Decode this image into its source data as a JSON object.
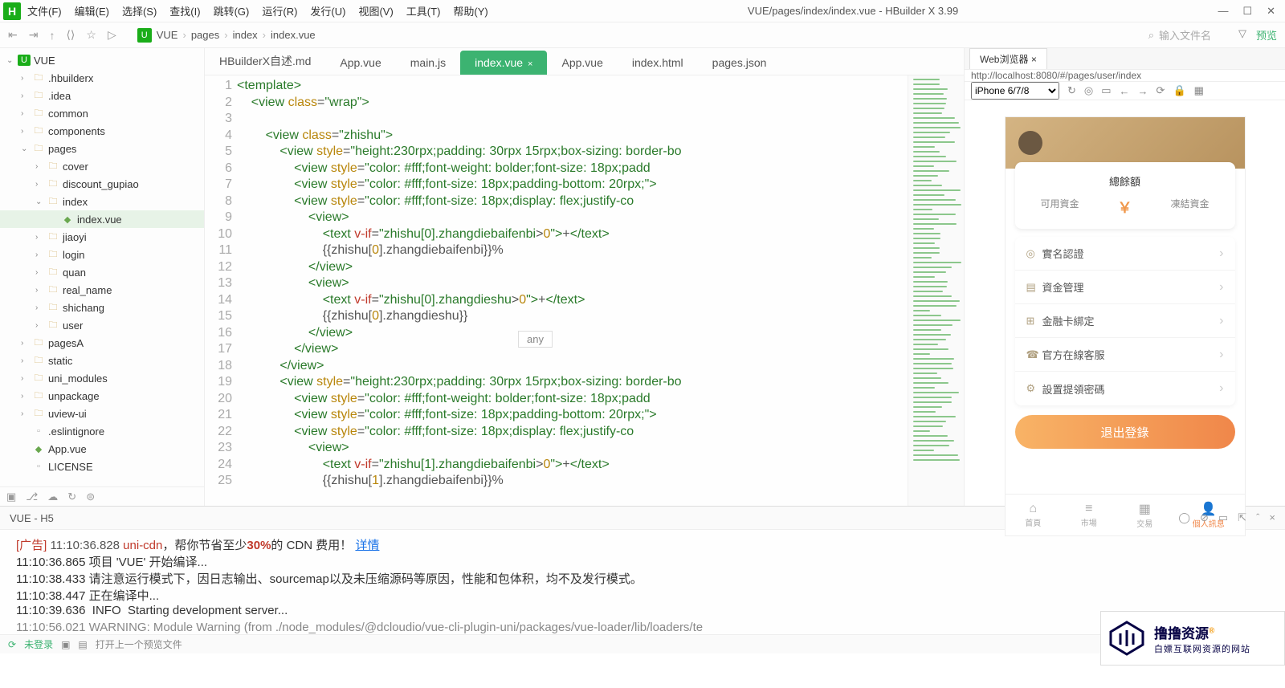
{
  "window": {
    "title": "VUE/pages/index/index.vue - HBuilder X 3.99"
  },
  "menu": [
    "文件(F)",
    "编辑(E)",
    "选择(S)",
    "查找(I)",
    "跳转(G)",
    "运行(R)",
    "发行(U)",
    "视图(V)",
    "工具(T)",
    "帮助(Y)"
  ],
  "breadcrumbs": [
    "VUE",
    "pages",
    "index",
    "index.vue"
  ],
  "search_placeholder": "输入文件名",
  "preview_label": "预览",
  "tree": [
    {
      "d": 0,
      "t": "VUE",
      "icon": "u",
      "open": true
    },
    {
      "d": 1,
      "t": ".hbuilderx",
      "icon": "f"
    },
    {
      "d": 1,
      "t": ".idea",
      "icon": "f"
    },
    {
      "d": 1,
      "t": "common",
      "icon": "f"
    },
    {
      "d": 1,
      "t": "components",
      "icon": "f"
    },
    {
      "d": 1,
      "t": "pages",
      "icon": "f",
      "open": true
    },
    {
      "d": 2,
      "t": "cover",
      "icon": "f"
    },
    {
      "d": 2,
      "t": "discount_gupiao",
      "icon": "f"
    },
    {
      "d": 2,
      "t": "index",
      "icon": "f",
      "open": true
    },
    {
      "d": 3,
      "t": "index.vue",
      "icon": "v",
      "sel": true
    },
    {
      "d": 2,
      "t": "jiaoyi",
      "icon": "f"
    },
    {
      "d": 2,
      "t": "login",
      "icon": "f"
    },
    {
      "d": 2,
      "t": "quan",
      "icon": "f"
    },
    {
      "d": 2,
      "t": "real_name",
      "icon": "f"
    },
    {
      "d": 2,
      "t": "shichang",
      "icon": "f"
    },
    {
      "d": 2,
      "t": "user",
      "icon": "f"
    },
    {
      "d": 1,
      "t": "pagesA",
      "icon": "f"
    },
    {
      "d": 1,
      "t": "static",
      "icon": "f"
    },
    {
      "d": 1,
      "t": "uni_modules",
      "icon": "f"
    },
    {
      "d": 1,
      "t": "unpackage",
      "icon": "f"
    },
    {
      "d": 1,
      "t": "uview-ui",
      "icon": "f"
    },
    {
      "d": 1,
      "t": ".eslintignore",
      "icon": "file"
    },
    {
      "d": 1,
      "t": "App.vue",
      "icon": "v"
    },
    {
      "d": 1,
      "t": "LICENSE",
      "icon": "file"
    }
  ],
  "tabs": [
    {
      "label": "HBuilderX自述.md"
    },
    {
      "label": "App.vue"
    },
    {
      "label": "main.js"
    },
    {
      "label": "index.vue",
      "active": true,
      "close": true
    },
    {
      "label": "App.vue"
    },
    {
      "label": "index.html"
    },
    {
      "label": "pages.json"
    }
  ],
  "code_hint": "any",
  "code_lines": [
    {
      "n": 1,
      "seg": [
        [
          "tag",
          "<"
        ],
        [
          "tag",
          "template"
        ],
        [
          "tag",
          ">"
        ]
      ]
    },
    {
      "n": 2,
      "seg": [
        [
          "txt",
          "    "
        ],
        [
          "tag",
          "<"
        ],
        [
          "tag",
          "view "
        ],
        [
          "attr",
          "class"
        ],
        [
          "txt",
          "="
        ],
        [
          "str",
          "\"wrap\""
        ],
        [
          "tag",
          ">"
        ]
      ]
    },
    {
      "n": 3,
      "seg": []
    },
    {
      "n": 4,
      "seg": [
        [
          "txt",
          "        "
        ],
        [
          "tag",
          "<"
        ],
        [
          "tag",
          "view "
        ],
        [
          "attr",
          "class"
        ],
        [
          "txt",
          "="
        ],
        [
          "str",
          "\"zhishu\""
        ],
        [
          "tag",
          ">"
        ]
      ]
    },
    {
      "n": 5,
      "seg": [
        [
          "txt",
          "            "
        ],
        [
          "tag",
          "<"
        ],
        [
          "tag",
          "view "
        ],
        [
          "attr",
          "style"
        ],
        [
          "txt",
          "="
        ],
        [
          "str",
          "\"height:230rpx;padding: 30rpx 15rpx;box-sizing: border-bo"
        ]
      ]
    },
    {
      "n": 6,
      "seg": [
        [
          "txt",
          "                "
        ],
        [
          "tag",
          "<"
        ],
        [
          "tag",
          "view "
        ],
        [
          "attr",
          "style"
        ],
        [
          "txt",
          "="
        ],
        [
          "str",
          "\"color: #fff;font-weight: bolder;font-size: 18px;padd"
        ]
      ]
    },
    {
      "n": 7,
      "seg": [
        [
          "txt",
          "                "
        ],
        [
          "tag",
          "<"
        ],
        [
          "tag",
          "view "
        ],
        [
          "attr",
          "style"
        ],
        [
          "txt",
          "="
        ],
        [
          "str",
          "\"color: #fff;font-size: 18px;padding-bottom: 20rpx;\""
        ],
        [
          "tag",
          ">"
        ]
      ]
    },
    {
      "n": 8,
      "seg": [
        [
          "txt",
          "                "
        ],
        [
          "tag",
          "<"
        ],
        [
          "tag",
          "view "
        ],
        [
          "attr",
          "style"
        ],
        [
          "txt",
          "="
        ],
        [
          "str",
          "\"color: #fff;font-size: 18px;display: flex;justify-co"
        ]
      ]
    },
    {
      "n": 9,
      "seg": [
        [
          "txt",
          "                    "
        ],
        [
          "tag",
          "<"
        ],
        [
          "tag",
          "view"
        ],
        [
          "tag",
          ">"
        ]
      ]
    },
    {
      "n": 10,
      "seg": [
        [
          "txt",
          "                        "
        ],
        [
          "tag",
          "<"
        ],
        [
          "tag",
          "text "
        ],
        [
          "dir",
          "v-if"
        ],
        [
          "txt",
          "="
        ],
        [
          "str",
          "\"zhishu[0].zhangdiebaifenbi"
        ],
        [
          "txt",
          ">"
        ],
        [
          "num",
          "0"
        ],
        [
          "str",
          "\""
        ],
        [
          "tag",
          ">"
        ],
        [
          "txt",
          "+"
        ],
        [
          "tag",
          "</"
        ],
        [
          "tag",
          "text"
        ],
        [
          "tag",
          ">"
        ]
      ]
    },
    {
      "n": 11,
      "seg": [
        [
          "txt",
          "                        {{zhishu["
        ],
        [
          "num",
          "0"
        ],
        [
          "txt",
          "].zhangdiebaifenbi}}%"
        ]
      ]
    },
    {
      "n": 12,
      "seg": [
        [
          "txt",
          "                    "
        ],
        [
          "tag",
          "</"
        ],
        [
          "tag",
          "view"
        ],
        [
          "tag",
          ">"
        ]
      ]
    },
    {
      "n": 13,
      "seg": [
        [
          "txt",
          "                    "
        ],
        [
          "tag",
          "<"
        ],
        [
          "tag",
          "view"
        ],
        [
          "tag",
          ">"
        ]
      ]
    },
    {
      "n": 14,
      "seg": [
        [
          "txt",
          "                        "
        ],
        [
          "tag",
          "<"
        ],
        [
          "tag",
          "text "
        ],
        [
          "dir",
          "v-if"
        ],
        [
          "txt",
          "="
        ],
        [
          "str",
          "\"zhishu[0].zhangdieshu"
        ],
        [
          "txt",
          ">"
        ],
        [
          "num",
          "0"
        ],
        [
          "str",
          "\""
        ],
        [
          "tag",
          ">"
        ],
        [
          "txt",
          "+"
        ],
        [
          "tag",
          "</"
        ],
        [
          "tag",
          "text"
        ],
        [
          "tag",
          ">"
        ]
      ]
    },
    {
      "n": 15,
      "seg": [
        [
          "txt",
          "                        {{zhishu["
        ],
        [
          "num",
          "0"
        ],
        [
          "txt",
          "].zhangdieshu}}"
        ]
      ]
    },
    {
      "n": 16,
      "seg": [
        [
          "txt",
          "                    "
        ],
        [
          "tag",
          "</"
        ],
        [
          "tag",
          "view"
        ],
        [
          "tag",
          ">"
        ]
      ]
    },
    {
      "n": 17,
      "seg": [
        [
          "txt",
          "                "
        ],
        [
          "tag",
          "</"
        ],
        [
          "tag",
          "view"
        ],
        [
          "tag",
          ">"
        ]
      ]
    },
    {
      "n": 18,
      "seg": [
        [
          "txt",
          "            "
        ],
        [
          "tag",
          "</"
        ],
        [
          "tag",
          "view"
        ],
        [
          "tag",
          ">"
        ]
      ]
    },
    {
      "n": 19,
      "seg": [
        [
          "txt",
          "            "
        ],
        [
          "tag",
          "<"
        ],
        [
          "tag",
          "view "
        ],
        [
          "attr",
          "style"
        ],
        [
          "txt",
          "="
        ],
        [
          "str",
          "\"height:230rpx;padding: 30rpx 15rpx;box-sizing: border-bo"
        ]
      ]
    },
    {
      "n": 20,
      "seg": [
        [
          "txt",
          "                "
        ],
        [
          "tag",
          "<"
        ],
        [
          "tag",
          "view "
        ],
        [
          "attr",
          "style"
        ],
        [
          "txt",
          "="
        ],
        [
          "str",
          "\"color: #fff;font-weight: bolder;font-size: 18px;padd"
        ]
      ]
    },
    {
      "n": 21,
      "seg": [
        [
          "txt",
          "                "
        ],
        [
          "tag",
          "<"
        ],
        [
          "tag",
          "view "
        ],
        [
          "attr",
          "style"
        ],
        [
          "txt",
          "="
        ],
        [
          "str",
          "\"color: #fff;font-size: 18px;padding-bottom: 20rpx;\""
        ],
        [
          "tag",
          ">"
        ]
      ]
    },
    {
      "n": 22,
      "seg": [
        [
          "txt",
          "                "
        ],
        [
          "tag",
          "<"
        ],
        [
          "tag",
          "view "
        ],
        [
          "attr",
          "style"
        ],
        [
          "txt",
          "="
        ],
        [
          "str",
          "\"color: #fff;font-size: 18px;display: flex;justify-co"
        ]
      ]
    },
    {
      "n": 23,
      "seg": [
        [
          "txt",
          "                    "
        ],
        [
          "tag",
          "<"
        ],
        [
          "tag",
          "view"
        ],
        [
          "tag",
          ">"
        ]
      ]
    },
    {
      "n": 24,
      "seg": [
        [
          "txt",
          "                        "
        ],
        [
          "tag",
          "<"
        ],
        [
          "tag",
          "text "
        ],
        [
          "dir",
          "v-if"
        ],
        [
          "txt",
          "="
        ],
        [
          "str",
          "\"zhishu[1].zhangdiebaifenbi"
        ],
        [
          "txt",
          ">"
        ],
        [
          "num",
          "0"
        ],
        [
          "str",
          "\""
        ],
        [
          "tag",
          ">"
        ],
        [
          "txt",
          "+"
        ],
        [
          "tag",
          "</"
        ],
        [
          "tag",
          "text"
        ],
        [
          "tag",
          ">"
        ]
      ]
    },
    {
      "n": 25,
      "seg": [
        [
          "txt",
          "                        {{zhishu["
        ],
        [
          "num",
          "1"
        ],
        [
          "txt",
          "].zhangdiebaifenbi}}%"
        ]
      ]
    }
  ],
  "console_title": "VUE - H5",
  "console": {
    "ad_label": "[广告]",
    "ad_time": "11:10:36.828",
    "ad_cdn": "uni-cdn",
    "ad_mid": "，帮你节省至少",
    "ad_pct": "30%",
    "ad_tail": "的 CDN 费用！",
    "ad_link": "详情",
    "l2": "11:10:36.865 项目 'VUE' 开始编译...",
    "l3": "11:10:38.433 请注意运行模式下，因日志输出、sourcemap以及未压缩源码等原因，性能和包体积，均不及发行模式。",
    "l4": "11:10:38.447 正在编译中...",
    "l5": "11:10:39.636  INFO  Starting development server...",
    "l6": "11:10:56.021 WARNING: Module Warning (from ./node_modules/@dcloudio/vue-cli-plugin-uni/packages/vue-loader/lib/loaders/te"
  },
  "status": {
    "login": "未登录",
    "tip": "打开上一个预览文件"
  },
  "preview": {
    "tab": "Web浏览器",
    "url": "http://localhost:8080/#/pages/user/index",
    "device": "iPhone 6/7/8",
    "balance_title": "總餘額",
    "available": "可用資金",
    "yen": "￥",
    "frozen": "凍結資金",
    "menu": [
      "實名認證",
      "資金管理",
      "金融卡綁定",
      "官方在線客服",
      "設置提領密碼"
    ],
    "logout": "退出登錄",
    "tabs": [
      {
        "l": "首頁",
        "i": "⌂"
      },
      {
        "l": "市場",
        "i": "≡"
      },
      {
        "l": "交易",
        "i": "▦"
      },
      {
        "l": "個人訊息",
        "i": "👤",
        "active": true
      }
    ]
  },
  "watermark": {
    "l1": "撸撸资源",
    "sup": "®",
    "l2": "白嫖互联网资源的网站"
  }
}
